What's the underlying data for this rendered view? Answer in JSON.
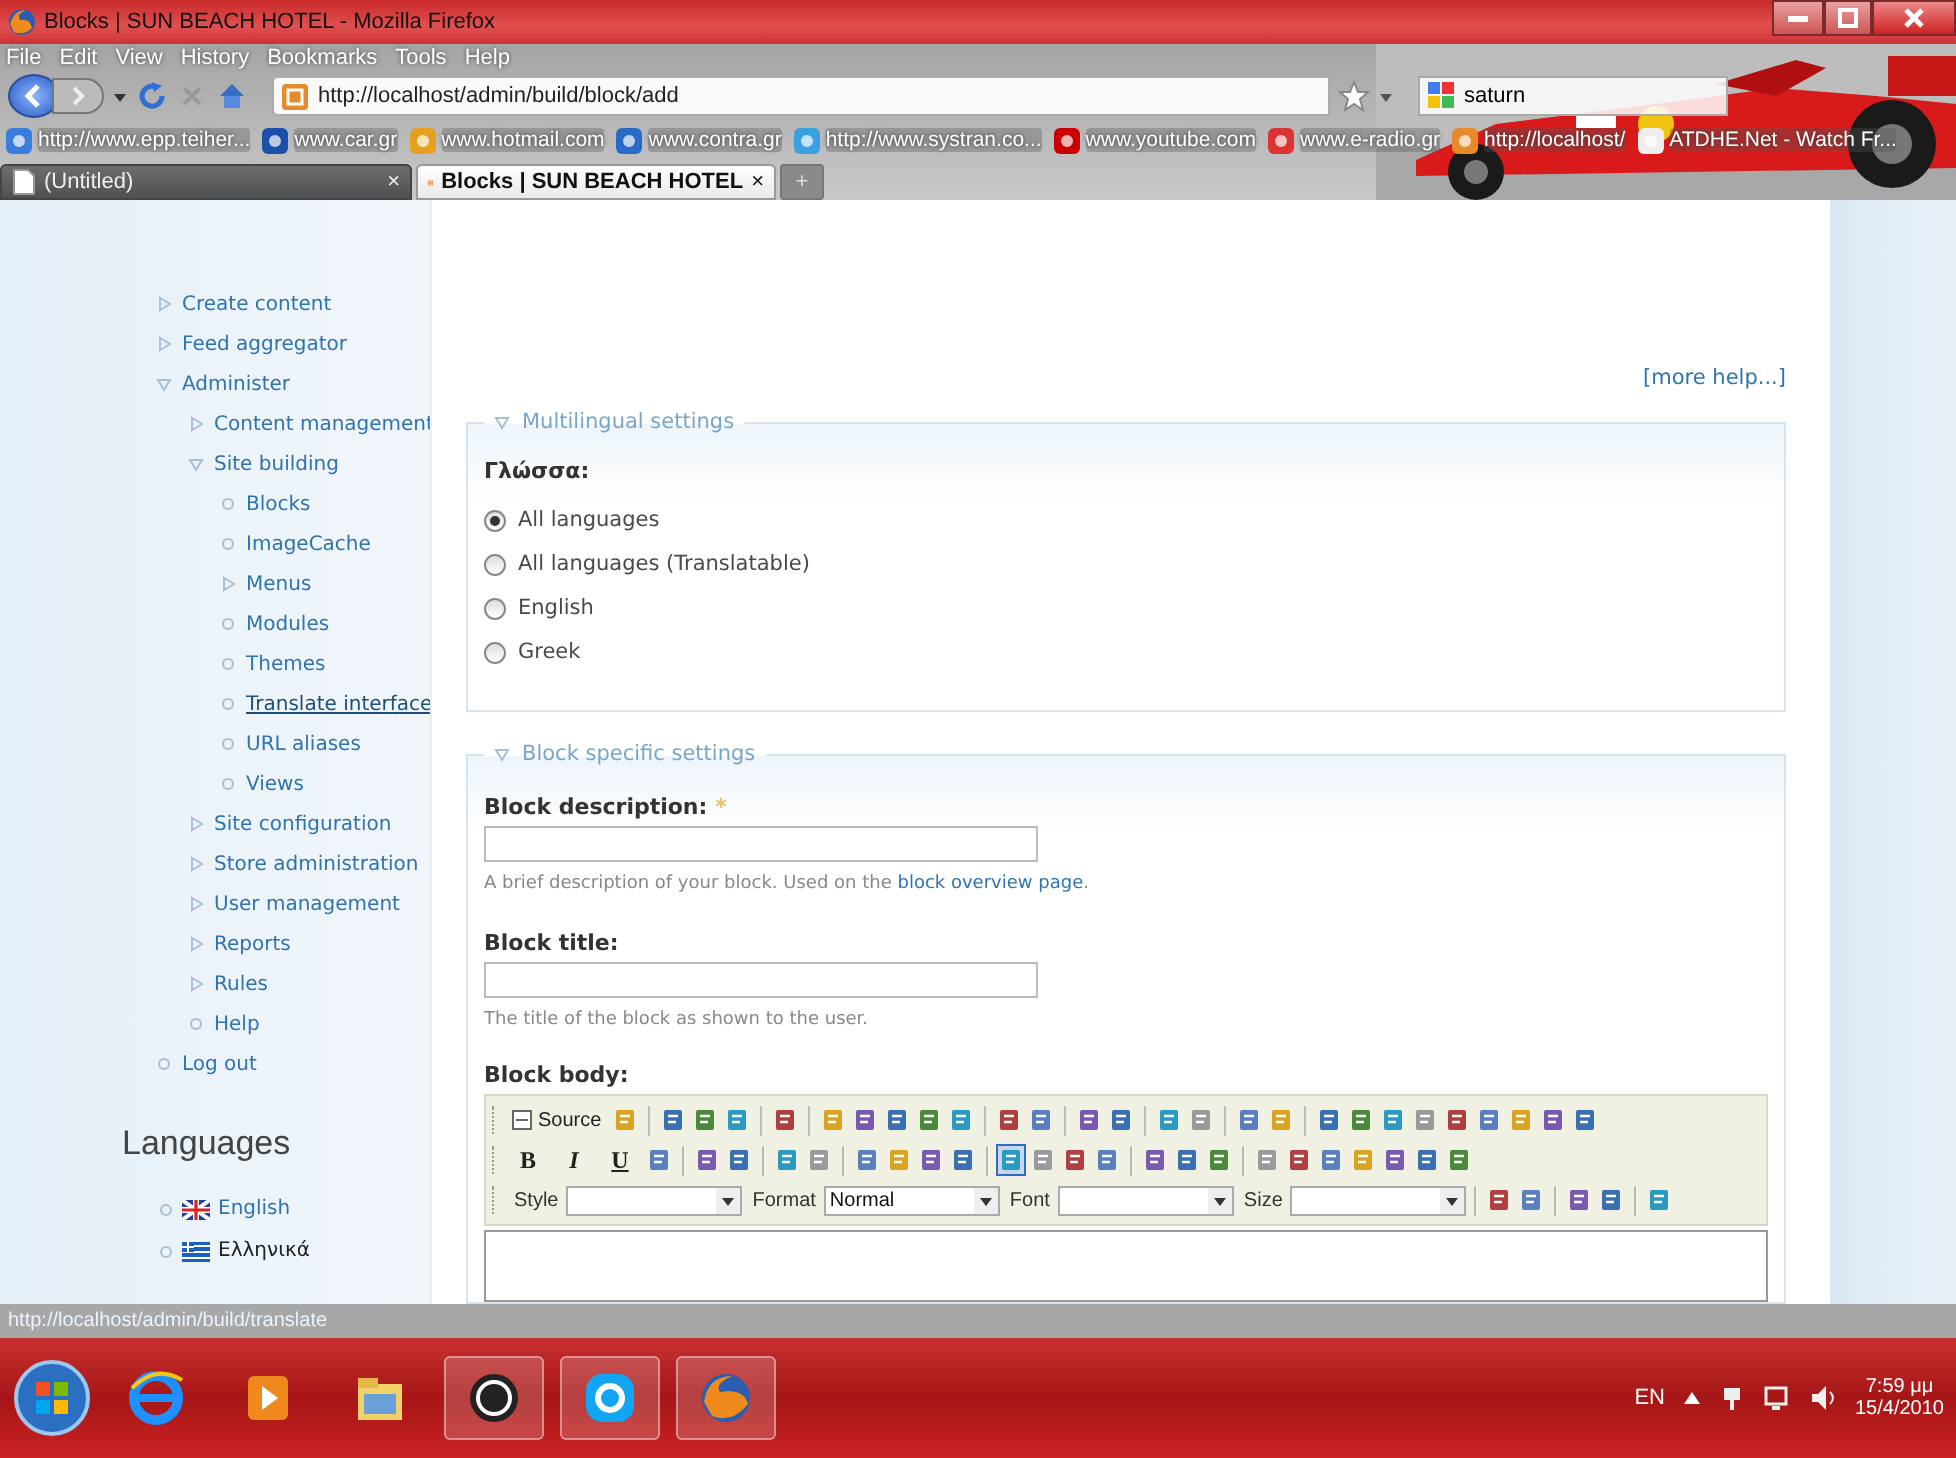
{
  "window": {
    "title": "Blocks | SUN BEACH HOTEL - Mozilla Firefox"
  },
  "menu": [
    "File",
    "Edit",
    "View",
    "History",
    "Bookmarks",
    "Tools",
    "Help"
  ],
  "navigation": {
    "url": "http://localhost/admin/build/block/add",
    "search": "saturn"
  },
  "bookmarks": [
    "http://www.epp.teiher...",
    "www.car.gr",
    "www.hotmail.com",
    "www.contra.gr",
    "http://www.systran.co...",
    "www.youtube.com",
    "www.e-radio.gr",
    "http://localhost/",
    "ATDHE.Net - Watch Fr..."
  ],
  "tabs": [
    {
      "label": "(Untitled)",
      "close": "×",
      "selected": false
    },
    {
      "label": "Blocks | SUN BEACH HOTEL",
      "close": "×",
      "selected": true
    }
  ],
  "new_tab": "+",
  "sidebar": {
    "items": [
      {
        "label": "Create content",
        "kind": "collapsed",
        "hovered": false
      },
      {
        "label": "Feed aggregator",
        "kind": "collapsed",
        "hovered": false
      },
      {
        "label": "Administer",
        "kind": "expanded",
        "hovered": false,
        "children": [
          {
            "label": "Content management",
            "kind": "collapsed",
            "hovered": false
          },
          {
            "label": "Site building",
            "kind": "expanded",
            "hovered": false,
            "children": [
              {
                "label": "Blocks",
                "kind": "leaf",
                "hovered": false
              },
              {
                "label": "ImageCache",
                "kind": "leaf",
                "hovered": false
              },
              {
                "label": "Menus",
                "kind": "collapsed",
                "hovered": false
              },
              {
                "label": "Modules",
                "kind": "leaf",
                "hovered": false
              },
              {
                "label": "Themes",
                "kind": "leaf",
                "hovered": false
              },
              {
                "label": "Translate interface",
                "kind": "leaf",
                "hovered": true
              },
              {
                "label": "URL aliases",
                "kind": "leaf",
                "hovered": false
              },
              {
                "label": "Views",
                "kind": "leaf",
                "hovered": false
              }
            ]
          },
          {
            "label": "Site configuration",
            "kind": "collapsed",
            "hovered": false
          },
          {
            "label": "Store administration",
            "kind": "collapsed",
            "hovered": false
          },
          {
            "label": "User management",
            "kind": "collapsed",
            "hovered": false
          },
          {
            "label": "Reports",
            "kind": "collapsed",
            "hovered": false
          },
          {
            "label": "Rules",
            "kind": "collapsed",
            "hovered": false
          },
          {
            "label": "Help",
            "kind": "leaf",
            "hovered": false
          }
        ]
      },
      {
        "label": "Log out",
        "kind": "leaf",
        "hovered": false
      }
    ],
    "languages": {
      "title": "Languages",
      "items": [
        {
          "label": "English",
          "kind": "uk",
          "selected": false
        },
        {
          "label": "Ελληνικά",
          "kind": "gr",
          "selected": true
        }
      ]
    }
  },
  "help_link": "[more help...]",
  "multilingual": {
    "legend": "Multilingual settings",
    "label": "Γλώσσα:",
    "options": [
      {
        "label": "All languages",
        "selected": true
      },
      {
        "label": "All languages (Translatable)",
        "selected": false
      },
      {
        "label": "English",
        "selected": false
      },
      {
        "label": "Greek",
        "selected": false
      }
    ]
  },
  "block_settings": {
    "legend": "Block specific settings",
    "fields": [
      {
        "label": "Block description:",
        "required_mark": "*",
        "description": "A brief description of your block. Used on the ",
        "link": "block overview page",
        "description_end": "."
      },
      {
        "label": "Block title:",
        "description": "The title of the block as shown to the user."
      }
    ],
    "body_label": "Block body:",
    "toolbar": [
      [
        {
          "kind": "button",
          "label": "Source"
        },
        {
          "kind": "icon",
          "on": false
        },
        {
          "kind": "sep"
        },
        {
          "kind": "icon",
          "on": false
        },
        {
          "kind": "icon",
          "on": false
        },
        {
          "kind": "icon",
          "on": false
        },
        {
          "kind": "sep"
        },
        {
          "kind": "icon",
          "on": false
        },
        {
          "kind": "sep"
        },
        {
          "kind": "icon",
          "on": false
        },
        {
          "kind": "icon",
          "on": false
        },
        {
          "kind": "icon",
          "on": false
        },
        {
          "kind": "icon",
          "on": false
        },
        {
          "kind": "icon",
          "on": false
        },
        {
          "kind": "sep"
        },
        {
          "kind": "icon",
          "on": false
        },
        {
          "kind": "icon",
          "on": false
        },
        {
          "kind": "sep"
        },
        {
          "kind": "icon",
          "on": false
        },
        {
          "kind": "icon",
          "on": false
        },
        {
          "kind": "sep"
        },
        {
          "kind": "icon",
          "on": false
        },
        {
          "kind": "icon",
          "on": false
        },
        {
          "kind": "sep"
        },
        {
          "kind": "icon",
          "on": false
        },
        {
          "kind": "icon",
          "on": false
        },
        {
          "kind": "sep"
        },
        {
          "kind": "icon",
          "on": false
        },
        {
          "kind": "icon",
          "on": false
        },
        {
          "kind": "icon",
          "on": false
        },
        {
          "kind": "icon",
          "on": false
        },
        {
          "kind": "icon",
          "on": false
        },
        {
          "kind": "icon",
          "on": false
        },
        {
          "kind": "icon",
          "on": false
        },
        {
          "kind": "icon",
          "on": false
        },
        {
          "kind": "icon",
          "on": false
        }
      ],
      [
        {
          "kind": "text",
          "label": "B"
        },
        {
          "kind": "text",
          "label": "I"
        },
        {
          "kind": "text",
          "label": "U"
        },
        {
          "kind": "icon",
          "on": false
        },
        {
          "kind": "sep"
        },
        {
          "kind": "icon",
          "on": false
        },
        {
          "kind": "icon",
          "on": false
        },
        {
          "kind": "sep"
        },
        {
          "kind": "icon",
          "on": false
        },
        {
          "kind": "icon",
          "on": false
        },
        {
          "kind": "sep"
        },
        {
          "kind": "icon",
          "on": false
        },
        {
          "kind": "icon",
          "on": false
        },
        {
          "kind": "icon",
          "on": false
        },
        {
          "kind": "icon",
          "on": false
        },
        {
          "kind": "sep"
        },
        {
          "kind": "icon",
          "on": true
        },
        {
          "kind": "icon",
          "on": false
        },
        {
          "kind": "icon",
          "on": false
        },
        {
          "kind": "icon",
          "on": false
        },
        {
          "kind": "sep"
        },
        {
          "kind": "icon",
          "on": false
        },
        {
          "kind": "icon",
          "on": false
        },
        {
          "kind": "icon",
          "on": false
        },
        {
          "kind": "sep"
        },
        {
          "kind": "icon",
          "on": false
        },
        {
          "kind": "icon",
          "on": false
        },
        {
          "kind": "icon",
          "on": false
        },
        {
          "kind": "icon",
          "on": false
        },
        {
          "kind": "icon",
          "on": false
        },
        {
          "kind": "icon",
          "on": false
        },
        {
          "kind": "icon",
          "on": false
        }
      ],
      [
        {
          "kind": "combo",
          "label": "Style"
        },
        {
          "kind": "combo",
          "label": "Format",
          "value": "Normal"
        },
        {
          "kind": "combo",
          "label": "Font"
        },
        {
          "kind": "combo",
          "label": "Size"
        },
        {
          "kind": "sep"
        },
        {
          "kind": "icon",
          "on": false
        },
        {
          "kind": "icon",
          "on": false
        },
        {
          "kind": "sep"
        },
        {
          "kind": "icon",
          "on": false
        },
        {
          "kind": "icon",
          "on": false
        },
        {
          "kind": "sep"
        },
        {
          "kind": "icon",
          "on": false
        }
      ]
    ]
  },
  "status_bar": "http://localhost/admin/build/translate",
  "taskbar": {
    "language": "EN",
    "time": "7:59 μμ",
    "date": "15/4/2010"
  }
}
